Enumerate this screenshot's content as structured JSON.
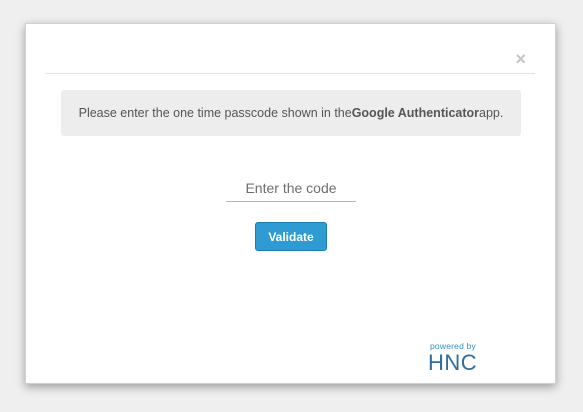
{
  "dialog": {
    "close_glyph": "×",
    "notice_before": "Please enter the one time passcode shown in the ",
    "notice_app": "Google Authenticator",
    "notice_after": " app.",
    "code_placeholder": "Enter the code",
    "code_value": "",
    "validate_label": "Validate"
  },
  "branding": {
    "powered_by": "powered by",
    "logo_text": "HNC"
  },
  "colors": {
    "accent": "#2f9bd3",
    "notice_bg": "#ededed",
    "page_bg": "#efefef"
  }
}
